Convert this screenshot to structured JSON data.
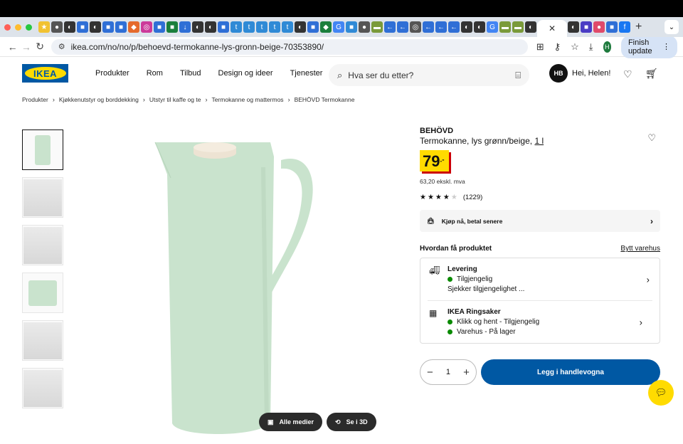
{
  "browser": {
    "url": "ikea.com/no/no/p/behoevd-termokanne-lys-gronn-beige-70353890/",
    "finish_update_label": "Finish update",
    "profile_initial": "H"
  },
  "header": {
    "logo_text": "IKEA",
    "nav": [
      "Produkter",
      "Rom",
      "Tilbud",
      "Design og ideer",
      "Tjenester"
    ],
    "search_placeholder": "Hva ser du etter?",
    "user_initials": "HB",
    "greeting": "Hei, Helen!"
  },
  "breadcrumb": [
    "Produkter",
    "Kjøkkenutstyr og borddekking",
    "Utstyr til kaffe og te",
    "Termokanne og mattermos",
    "BEHÖVD Termokanne"
  ],
  "gallery": {
    "all_media_label": "Alle medier",
    "view_3d_label": "Se i 3D"
  },
  "product": {
    "brand": "BEHÖVD",
    "description": "Termokanne, lys grønn/beige,",
    "size": "1 l",
    "price_main": "79",
    "price_suffix": ".-",
    "price_excl_vat": "63,20 ekskl. mva",
    "rating_count": "(1229)",
    "rating_stars": 4,
    "klarna_label": "Kjøp nå, betal senere"
  },
  "availability": {
    "heading": "Hvordan få produktet",
    "change_store_label": "Bytt varehus",
    "delivery": {
      "title": "Levering",
      "status": "Tilgjengelig",
      "note": "Sjekker tilgjengelighet ..."
    },
    "store": {
      "title": "IKEA Ringsaker",
      "click_collect": "Klikk og hent - Tilgjengelig",
      "in_store": "Varehus - På lager"
    }
  },
  "cart": {
    "quantity": "1",
    "add_label": "Legg i handlevogna"
  },
  "colors": {
    "ikea_blue": "#0058a3",
    "ikea_yellow": "#ffdb00",
    "price_shadow": "#cc0008",
    "product_green": "#c9e3cd",
    "available": "#0a8a00"
  }
}
